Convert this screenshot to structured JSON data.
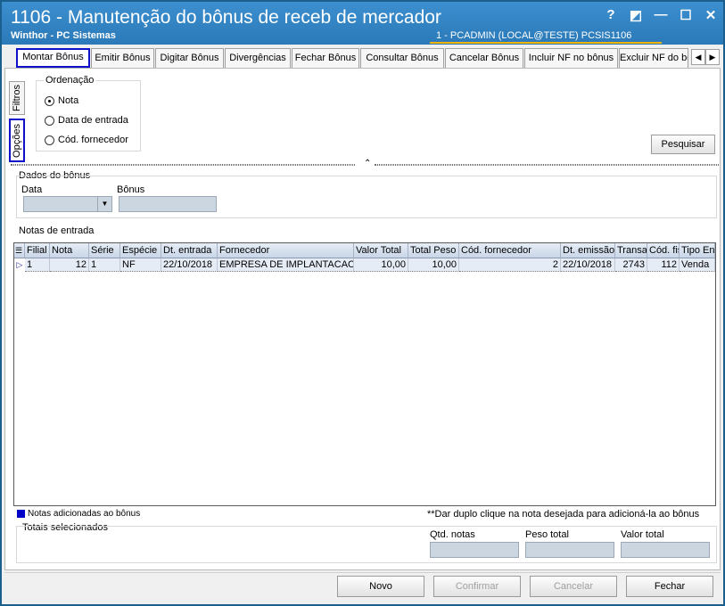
{
  "window": {
    "title": "1106 - Manutenção do bônus de receb de mercador",
    "subtitle": "Winthor - PC Sistemas",
    "session": "1 - PCADMIN (LOCAL@TESTE)   PCSIS1106",
    "controls": {
      "help": "?",
      "restore": "◩",
      "minimize": "—",
      "maximize": "☐",
      "close": "✕"
    }
  },
  "tabs": [
    {
      "label": "Montar Bônus"
    },
    {
      "label": "Emitir Bônus"
    },
    {
      "label": "Digitar Bônus"
    },
    {
      "label": "Divergências"
    },
    {
      "label": "Fechar Bônus"
    },
    {
      "label": "Consultar Bônus"
    },
    {
      "label": "Cancelar Bônus"
    },
    {
      "label": "Incluir NF no bônus"
    },
    {
      "label": "Excluir NF do bônus"
    }
  ],
  "tab_arrows": {
    "left": "◀",
    "right": "▶"
  },
  "side_tabs": {
    "filtros": "Filtros",
    "opcoes": "Opções"
  },
  "ordenacao": {
    "title": "Ordenação",
    "options": [
      "Nota",
      "Data de entrada",
      "Cód. fornecedor"
    ],
    "selected": "Nota"
  },
  "pesquisar_label": "Pesquisar",
  "splitter_caret": "⌃",
  "dados_bonus": {
    "title": "Dados do bônus",
    "data_label": "Data",
    "bonus_label": "Bônus",
    "dropdown_arrow": "▼"
  },
  "notas": {
    "title": "Notas de entrada",
    "columns": [
      "Filial",
      "Nota",
      "Série",
      "Espécie",
      "Dt. entrada",
      "Fornecedor",
      "Valor Total",
      "Total Peso",
      "Cód. fornecedor",
      "Dt. emissão",
      "Transação",
      "Cód. fiscal",
      "Tipo Entrada"
    ],
    "rows": [
      [
        "1",
        "12",
        "1",
        "NF",
        "22/10/2018",
        "EMPRESA DE IMPLANTACAO LTDA",
        "10,00",
        "10,00",
        "2",
        "22/10/2018",
        "2743",
        "112",
        "Venda"
      ]
    ],
    "row_indicator": "▷"
  },
  "legend_text": "Notas adicionadas ao bônus",
  "hint_text": "**Dar duplo clique na nota desejada para adicioná-la ao bônus",
  "totais": {
    "title": "Totais selecionados",
    "qtd_label": "Qtd. notas",
    "peso_label": "Peso total",
    "valor_label": "Valor total"
  },
  "buttons": {
    "novo": "Novo",
    "confirmar": "Confirmar",
    "cancelar": "Cancelar",
    "fechar": "Fechar"
  },
  "colors": {
    "titlebar": "#2b79b8",
    "highlight": "#1010c8",
    "field": "#ccd6e0",
    "legend_square": "#0000c8"
  }
}
